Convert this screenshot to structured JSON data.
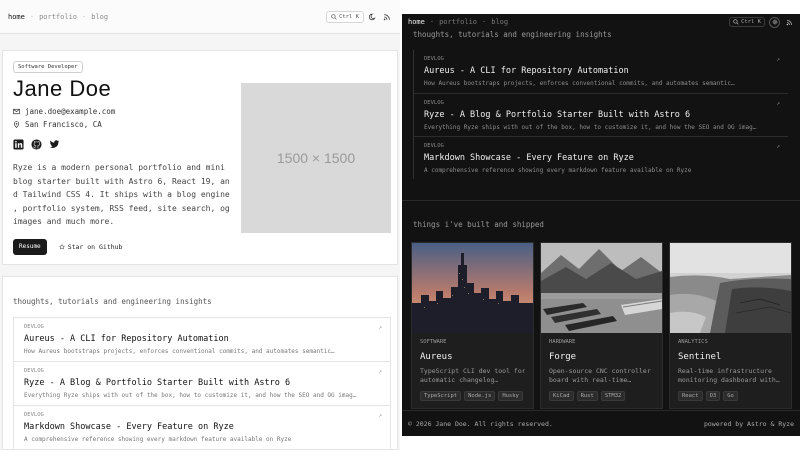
{
  "nav": {
    "home": "home",
    "portfolio": "portfolio",
    "blog": "blog",
    "separator": "·",
    "search_shortcut": "Ctrl K"
  },
  "profile": {
    "badge": "Software Developer",
    "name": "Jane Doe",
    "email": "jane.doe@example.com",
    "location": "San Francisco, CA",
    "bio_lines": [
      "Ryze is a modern personal portfolio and mini",
      "blog starter built with Astro 6, React 19, an",
      "d Tailwind CSS 4. It ships with a blog engine",
      ", portfolio system, RSS feed, site search, og",
      "images and much more."
    ],
    "resume_label": "Resume",
    "star_label": "Star on Github",
    "image_placeholder": "1500 × 1500"
  },
  "blog": {
    "subtitle": "thoughts, tutorials and engineering insights",
    "posts": [
      {
        "tag": "DEVLOG",
        "title": "Aureus - A CLI for Repository Automation",
        "desc_light": "How Aureus bootstraps projects, enforces conventional commits, and automates semantic…",
        "desc_dark": "How Aureus bootstraps projects, enforces conventional commits, and automates semantic…"
      },
      {
        "tag": "DEVLOG",
        "title": "Ryze - A Blog & Portfolio Starter Built with Astro 6",
        "desc_light": "Everything Ryze ships with out of the box, how to customize it, and how the SEO and OG imag…",
        "desc_dark": "Everything Ryze ships with out of the box, how to customize it, and how the SEO and OG imag…"
      },
      {
        "tag": "DEVLOG",
        "title": "Markdown Showcase - Every Feature on Ryze",
        "desc_light": "A comprehensive reference showing every markdown feature available on Ryze",
        "desc_dark": "A comprehensive reference showing every markdown feature available on Ryze"
      }
    ]
  },
  "projects": {
    "subtitle": "things i've built and shipped",
    "cards": [
      {
        "tag": "SOFTWARE",
        "name": "Aureus",
        "desc1": "TypeScript CLI dev tool for",
        "desc2": "automatic changelog…",
        "chips": [
          "TypeScript",
          "Node.js",
          "Husky"
        ]
      },
      {
        "tag": "HARDWARE",
        "name": "Forge",
        "desc1": "Open-source CNC controller",
        "desc2": "board with real-time…",
        "chips": [
          "KiCad",
          "Rust",
          "STM32"
        ]
      },
      {
        "tag": "ANALYTICS",
        "name": "Sentinel",
        "desc1": "Real-time infrastructure",
        "desc2": "monitoring dashboard with…",
        "chips": [
          "React",
          "D3",
          "Go"
        ]
      }
    ]
  },
  "footer": {
    "copyright": "© 2026 Jane Doe. All rights reserved.",
    "powered": "powered by Astro & Ryze"
  },
  "icons": {
    "search": "search-icon",
    "theme": "moon-icon",
    "rss": "rss-icon",
    "mail": "mail-icon",
    "location": "map-pin-icon",
    "linkedin": "linkedin-icon",
    "github": "github-icon",
    "twitter": "twitter-icon",
    "star": "star-icon",
    "arrow": "arrow-up-right-icon"
  }
}
